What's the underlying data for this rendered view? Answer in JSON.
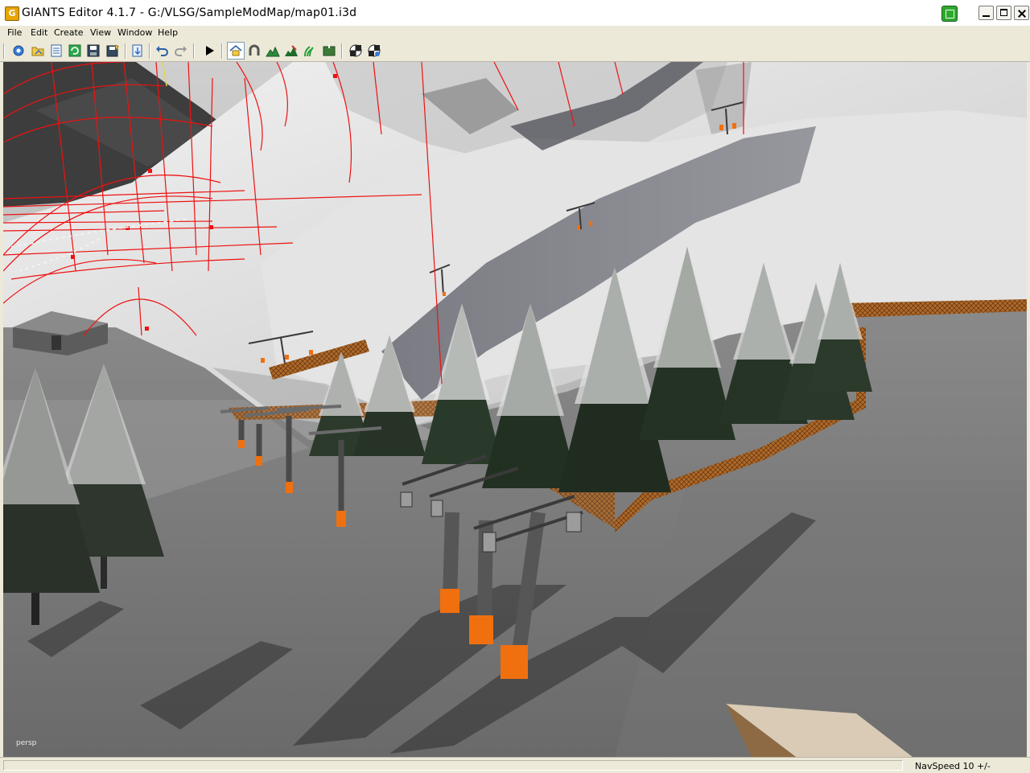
{
  "window": {
    "title": "GIANTS Editor 4.1.7 - G:/VLSG/SampleModMap/map01.i3d",
    "app_icon": "giants-logo-icon",
    "controls": [
      "minimize-icon",
      "maximize-icon",
      "close-icon"
    ]
  },
  "menu": {
    "items": [
      "File",
      "Edit",
      "Create",
      "View",
      "Window",
      "Help"
    ]
  },
  "toolbar": {
    "buttons": [
      "settings-icon",
      "open-icon",
      "list-icon",
      "refresh-icon",
      "save-icon",
      "save-as-icon",
      "import-icon",
      "undo-icon",
      "redo-icon",
      "play-icon",
      "home-view-icon",
      "magnet-icon",
      "terrain-sculpt-icon",
      "terrain-paint-icon",
      "foliage-paint-icon",
      "terrain-info-icon",
      "checker-icon",
      "checker-settings-icon"
    ],
    "active": "home-view-icon"
  },
  "viewport": {
    "camera_label": "persp",
    "scene": "ski-lift-winter-mountain"
  },
  "status": {
    "navspeed": "NavSpeed 10 +/-"
  },
  "colors": {
    "selection_wire": "#ee1111",
    "lift_accent": "#f07010",
    "snow": "#e6e6e6"
  }
}
